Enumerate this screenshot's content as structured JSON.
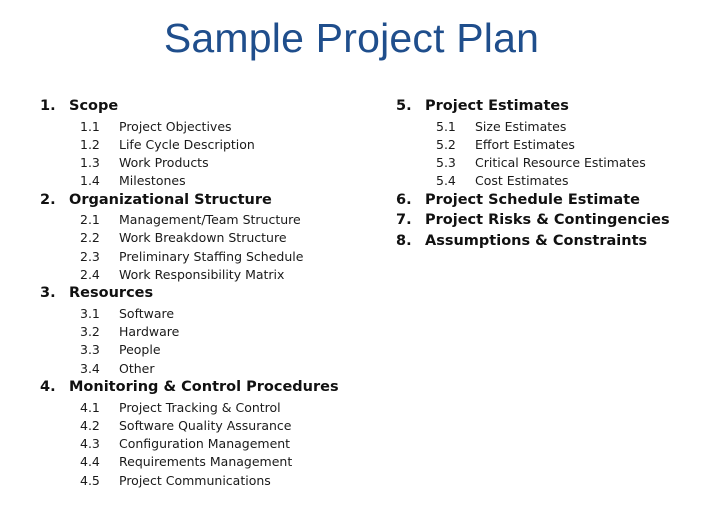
{
  "title": "Sample Project Plan",
  "left_sections": [
    {
      "num": "1.",
      "label": "Scope",
      "items": [
        {
          "num": "1.1",
          "label": "Project Objectives"
        },
        {
          "num": "1.2",
          "label": "Life Cycle Description"
        },
        {
          "num": "1.3",
          "label": "Work Products"
        },
        {
          "num": "1.4",
          "label": "Milestones"
        }
      ]
    },
    {
      "num": "2.",
      "label": "Organizational Structure",
      "items": [
        {
          "num": "2.1",
          "label": "Management/Team Structure"
        },
        {
          "num": "2.2",
          "label": "Work Breakdown Structure"
        },
        {
          "num": "2.3",
          "label": "Preliminary Staffing Schedule"
        },
        {
          "num": "2.4",
          "label": "Work Responsibility Matrix"
        }
      ]
    },
    {
      "num": "3.",
      "label": "Resources",
      "items": [
        {
          "num": "3.1",
          "label": "Software"
        },
        {
          "num": "3.2",
          "label": "Hardware"
        },
        {
          "num": "3.3",
          "label": "People"
        },
        {
          "num": "3.4",
          "label": "Other"
        }
      ]
    },
    {
      "num": "4.",
      "label": "Monitoring & Control Procedures",
      "items": [
        {
          "num": "4.1",
          "label": "Project Tracking & Control"
        },
        {
          "num": "4.2",
          "label": "Software Quality Assurance"
        },
        {
          "num": "4.3",
          "label": "Configuration Management"
        },
        {
          "num": "4.4",
          "label": "Requirements Management"
        },
        {
          "num": "4.5",
          "label": "Project Communications"
        }
      ]
    }
  ],
  "right_sections": [
    {
      "num": "5.",
      "label": "Project Estimates",
      "items": [
        {
          "num": "5.1",
          "label": "Size Estimates"
        },
        {
          "num": "5.2",
          "label": "Effort Estimates"
        },
        {
          "num": "5.3",
          "label": "Critical Resource Estimates"
        },
        {
          "num": "5.4",
          "label": "Cost Estimates"
        }
      ]
    },
    {
      "num": "6.",
      "label": "Project Schedule Estimate",
      "items": []
    },
    {
      "num": "7.",
      "label": "Project Risks & Contingencies",
      "items": []
    },
    {
      "num": "8.",
      "label": "Assumptions & Constraints",
      "items": []
    }
  ],
  "colors": {
    "title": "#1f4e8c",
    "text": "#111111",
    "background": "#ffffff"
  }
}
